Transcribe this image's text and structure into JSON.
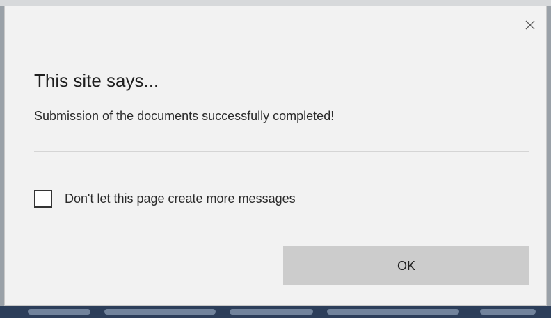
{
  "dialog": {
    "title": "This site says...",
    "message": "Submission of the documents successfully completed!",
    "checkbox_label": "Don't let this page create more messages",
    "checkbox_checked": false,
    "ok_label": "OK",
    "close_icon": "close-icon"
  },
  "colors": {
    "dialog_background": "#f2f2f2",
    "button_background": "#cccccc",
    "divider": "#d5d5d5"
  }
}
